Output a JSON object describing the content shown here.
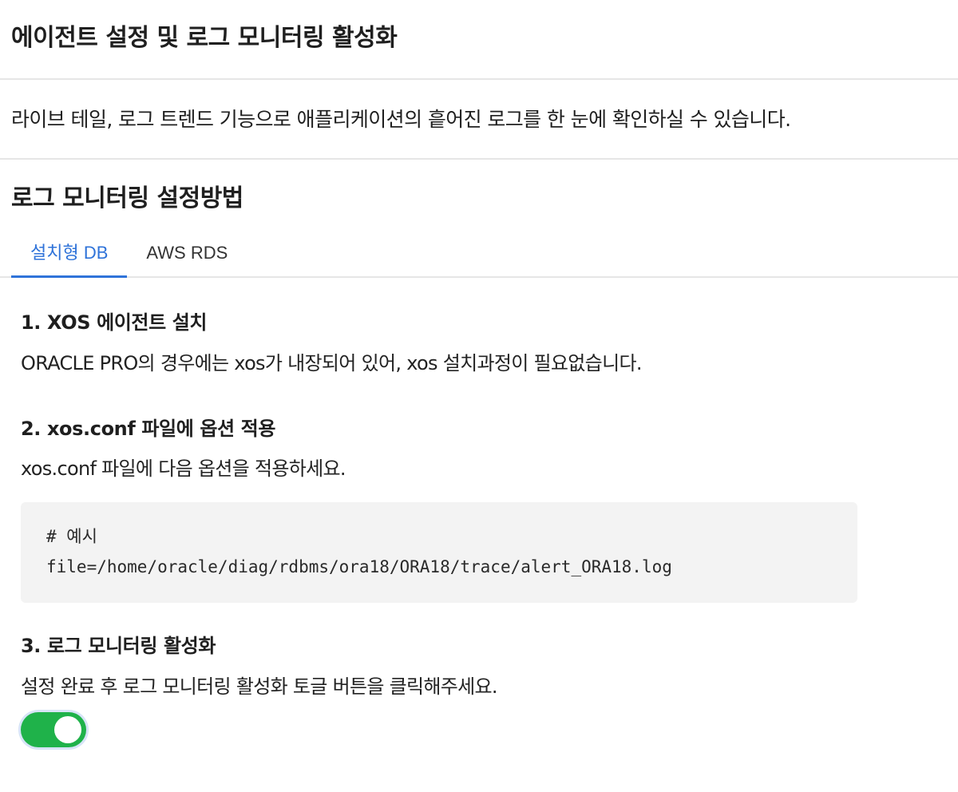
{
  "header": {
    "title": "에이전트 설정 및 로그 모니터링 활성화"
  },
  "intro": {
    "text": "라이브 테일, 로그 트렌드 기능으로 애플리케이션의 흩어진 로그를 한 눈에 확인하실 수 있습니다."
  },
  "section": {
    "title": "로그 모니터링 설정방법",
    "tabs": [
      {
        "label": "설치형 DB",
        "active": true
      },
      {
        "label": "AWS RDS",
        "active": false
      }
    ]
  },
  "steps": [
    {
      "title": "1. XOS 에이전트 설치",
      "description": "ORACLE PRO의 경우에는 xos가 내장되어 있어, xos 설치과정이 필요없습니다."
    },
    {
      "title": "2. xos.conf 파일에 옵션 적용",
      "description": "xos.conf 파일에 다음 옵션을 적용하세요.",
      "code": [
        "# 예시",
        "file=/home/oracle/diag/rdbms/ora18/ORA18/trace/alert_ORA18.log"
      ]
    },
    {
      "title": "3. 로그 모니터링 활성화",
      "description": "설정 완료 후 로그 모니터링 활성화 토글 버튼을 클릭해주세요.",
      "toggle": {
        "on": true,
        "color": "#1fb24a"
      }
    }
  ],
  "colors": {
    "accent": "#2f73d9",
    "toggle_on": "#1fb24a",
    "code_bg": "#f3f3f3"
  }
}
